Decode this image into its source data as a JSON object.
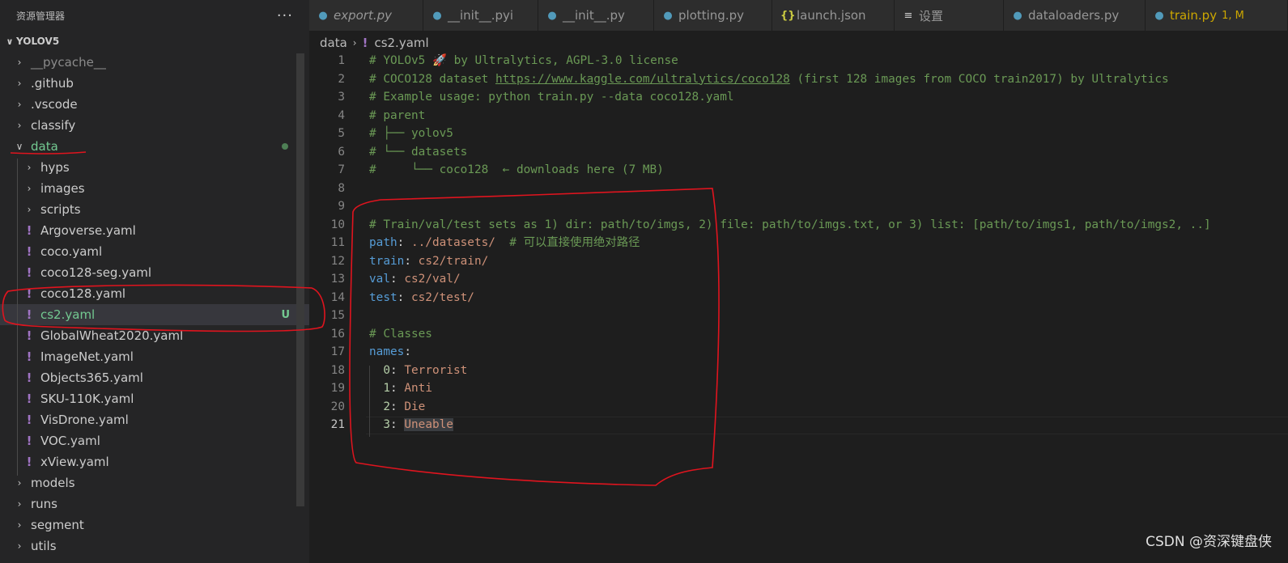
{
  "explorer": {
    "title": "资源管理器",
    "more_label": "···",
    "section": "YOLOV5",
    "items": [
      {
        "label": "__pycache__",
        "kind": "folder",
        "level": 0,
        "state": "collapsed",
        "dim": true
      },
      {
        "label": ".github",
        "kind": "folder",
        "level": 0,
        "state": "collapsed"
      },
      {
        "label": ".vscode",
        "kind": "folder",
        "level": 0,
        "state": "collapsed"
      },
      {
        "label": "classify",
        "kind": "folder",
        "level": 0,
        "state": "collapsed"
      },
      {
        "label": "data",
        "kind": "folder",
        "level": 0,
        "state": "expanded",
        "git": "dot",
        "color": "green"
      },
      {
        "label": "hyps",
        "kind": "folder",
        "level": 1,
        "state": "collapsed"
      },
      {
        "label": "images",
        "kind": "folder",
        "level": 1,
        "state": "collapsed"
      },
      {
        "label": "scripts",
        "kind": "folder",
        "level": 1,
        "state": "collapsed"
      },
      {
        "label": "Argoverse.yaml",
        "kind": "yaml",
        "level": 1
      },
      {
        "label": "coco.yaml",
        "kind": "yaml",
        "level": 1
      },
      {
        "label": "coco128-seg.yaml",
        "kind": "yaml",
        "level": 1
      },
      {
        "label": "coco128.yaml",
        "kind": "yaml",
        "level": 1
      },
      {
        "label": "cs2.yaml",
        "kind": "yaml",
        "level": 1,
        "active": true,
        "git": "U",
        "color": "green"
      },
      {
        "label": "GlobalWheat2020.yaml",
        "kind": "yaml",
        "level": 1
      },
      {
        "label": "ImageNet.yaml",
        "kind": "yaml",
        "level": 1
      },
      {
        "label": "Objects365.yaml",
        "kind": "yaml",
        "level": 1
      },
      {
        "label": "SKU-110K.yaml",
        "kind": "yaml",
        "level": 1
      },
      {
        "label": "VisDrone.yaml",
        "kind": "yaml",
        "level": 1
      },
      {
        "label": "VOC.yaml",
        "kind": "yaml",
        "level": 1
      },
      {
        "label": "xView.yaml",
        "kind": "yaml",
        "level": 1
      },
      {
        "label": "models",
        "kind": "folder",
        "level": 0,
        "state": "collapsed"
      },
      {
        "label": "runs",
        "kind": "folder",
        "level": 0,
        "state": "collapsed"
      },
      {
        "label": "segment",
        "kind": "folder",
        "level": 0,
        "state": "collapsed"
      },
      {
        "label": "utils",
        "kind": "folder",
        "level": 0,
        "state": "collapsed"
      }
    ]
  },
  "tabs": [
    {
      "label": "export.py",
      "icon": "python-icon",
      "italic": true
    },
    {
      "label": "__init__.pyi",
      "icon": "python-icon"
    },
    {
      "label": "__init__.py",
      "icon": "python-icon"
    },
    {
      "label": "plotting.py",
      "icon": "python-icon"
    },
    {
      "label": "launch.json",
      "icon": "json-icon"
    },
    {
      "label": "设置",
      "icon": "settings-icon"
    },
    {
      "label": "dataloaders.py",
      "icon": "python-icon"
    },
    {
      "label": "train.py",
      "icon": "python-icon",
      "badge": "1, M",
      "modified": true
    }
  ],
  "breadcrumb": {
    "folder": "data",
    "file": "cs2.yaml"
  },
  "editor": {
    "current_line": 21,
    "lines": [
      {
        "n": 1,
        "tokens": [
          [
            "c",
            "# YOLOv5 "
          ],
          [
            "rocket",
            "🚀"
          ],
          [
            "c",
            " by Ultralytics, AGPL-3.0 license"
          ]
        ]
      },
      {
        "n": 2,
        "tokens": [
          [
            "c",
            "# COCO128 dataset "
          ],
          [
            "link",
            "https://www.kaggle.com/ultralytics/coco128"
          ],
          [
            "c",
            " (first 128 images from COCO train2017) by Ultralytics"
          ]
        ]
      },
      {
        "n": 3,
        "tokens": [
          [
            "c",
            "# Example usage: python train.py --data coco128.yaml"
          ]
        ]
      },
      {
        "n": 4,
        "tokens": [
          [
            "c",
            "# parent"
          ]
        ]
      },
      {
        "n": 5,
        "tokens": [
          [
            "c",
            "# ├── yolov5"
          ]
        ]
      },
      {
        "n": 6,
        "tokens": [
          [
            "c",
            "# └── datasets"
          ]
        ]
      },
      {
        "n": 7,
        "tokens": [
          [
            "c",
            "#     └── coco128  ← downloads here (7 MB)"
          ]
        ]
      },
      {
        "n": 8,
        "tokens": []
      },
      {
        "n": 9,
        "tokens": []
      },
      {
        "n": 10,
        "tokens": [
          [
            "c",
            "# Train/val/test sets as 1) dir: path/to/imgs, 2) file: path/to/imgs.txt, or 3) list: [path/to/imgs1, path/to/imgs2, ..]"
          ]
        ]
      },
      {
        "n": 11,
        "tokens": [
          [
            "k",
            "path"
          ],
          [
            "t",
            ": "
          ],
          [
            "v",
            "../datasets/"
          ],
          [
            "t",
            "  "
          ],
          [
            "c",
            "# 可以直接使用绝对路径"
          ]
        ]
      },
      {
        "n": 12,
        "tokens": [
          [
            "k",
            "train"
          ],
          [
            "t",
            ": "
          ],
          [
            "v",
            "cs2/train/"
          ]
        ]
      },
      {
        "n": 13,
        "tokens": [
          [
            "k",
            "val"
          ],
          [
            "t",
            ": "
          ],
          [
            "v",
            "cs2/val/"
          ]
        ]
      },
      {
        "n": 14,
        "tokens": [
          [
            "k",
            "test"
          ],
          [
            "t",
            ": "
          ],
          [
            "v",
            "cs2/test/"
          ]
        ]
      },
      {
        "n": 15,
        "tokens": []
      },
      {
        "n": 16,
        "tokens": [
          [
            "c",
            "# Classes"
          ]
        ]
      },
      {
        "n": 17,
        "tokens": [
          [
            "k",
            "names"
          ],
          [
            "t",
            ":"
          ]
        ]
      },
      {
        "n": 18,
        "tokens": [
          [
            "t",
            "  "
          ],
          [
            "num",
            "0"
          ],
          [
            "t",
            ": "
          ],
          [
            "v",
            "Terrorist"
          ]
        ]
      },
      {
        "n": 19,
        "tokens": [
          [
            "t",
            "  "
          ],
          [
            "num",
            "1"
          ],
          [
            "t",
            ": "
          ],
          [
            "v",
            "Anti"
          ]
        ]
      },
      {
        "n": 20,
        "tokens": [
          [
            "t",
            "  "
          ],
          [
            "num",
            "2"
          ],
          [
            "t",
            ": "
          ],
          [
            "v",
            "Die"
          ]
        ]
      },
      {
        "n": 21,
        "tokens": [
          [
            "t",
            "  "
          ],
          [
            "num",
            "3"
          ],
          [
            "t",
            ": "
          ],
          [
            "vsel",
            "Uneable"
          ]
        ]
      }
    ]
  },
  "watermark": "CSDN @资深键盘侠",
  "colors": {
    "annotation_red": "#e0141e",
    "accent_yaml": "#a074c4",
    "git_untracked": "#73c991"
  }
}
